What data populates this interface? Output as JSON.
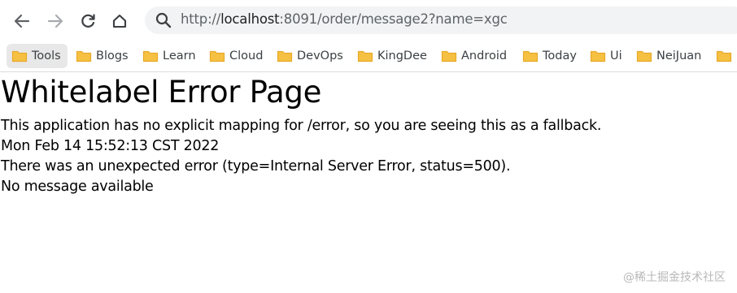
{
  "address_bar": {
    "url_prefix": "http://",
    "url_host": "localhost",
    "url_rest": ":8091/order/message2?name=xgc"
  },
  "bookmarks": [
    {
      "label": "Tools"
    },
    {
      "label": "Blogs"
    },
    {
      "label": "Learn"
    },
    {
      "label": "Cloud"
    },
    {
      "label": "DevOps"
    },
    {
      "label": "KingDee"
    },
    {
      "label": "Android"
    },
    {
      "label": "Today"
    },
    {
      "label": "Ui"
    },
    {
      "label": "NeiJuan"
    }
  ],
  "page": {
    "title": "Whitelabel Error Page",
    "line1": "This application has no explicit mapping for /error, so you are seeing this as a fallback.",
    "timestamp": "Mon Feb 14 15:52:13 CST 2022",
    "error_line": "There was an unexpected error (type=Internal Server Error, status=500).",
    "message": "No message available"
  },
  "watermark": "@稀土掘金技术社区",
  "colors": {
    "folder": "#f6c142",
    "folder_dark": "#e8a92a",
    "icon": "#5f6368"
  }
}
